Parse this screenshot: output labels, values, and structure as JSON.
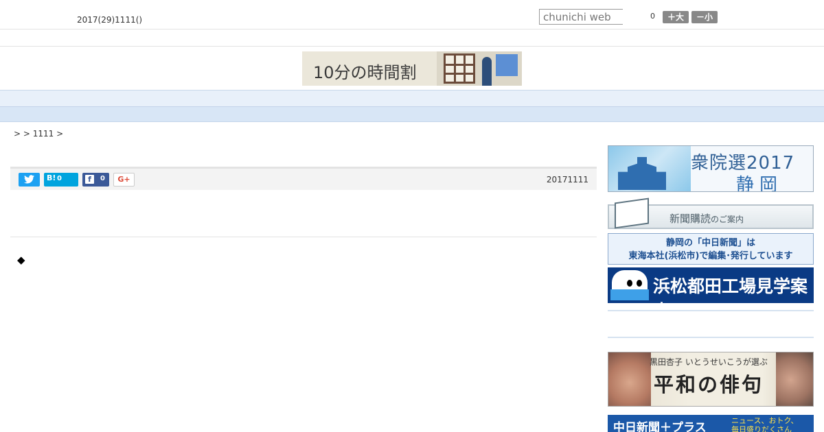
{
  "header": {
    "date": "2017(29)1111()",
    "search_placeholder": "chunichi web",
    "font_size_count": "0",
    "font_bigger_label": "＋大",
    "font_smaller_label": "－小"
  },
  "banner": {
    "text": "10分の時間割"
  },
  "nav": {
    "items": [
      "　　",
      "　　",
      "　　",
      "　　",
      "　　",
      "　　",
      "　　",
      "　　",
      "　　"
    ]
  },
  "breadcrumb": {
    "text": ">  > 1111 >"
  },
  "share": {
    "hatena_label": "B!",
    "hatena_count": "0",
    "facebook_icon": "f",
    "facebook_count": "0",
    "google_label": "G+",
    "article_date": "20171111"
  },
  "article": {
    "bullet": "◆"
  },
  "sidebar": {
    "election_title": "衆院選2017",
    "election_place": "静岡",
    "subscribe_main": "新聞購読",
    "subscribe_sub": "のご案内",
    "info_line1": "静岡の「中日新聞」は",
    "info_line2": "東海本社(浜松市)で編集･発行しています",
    "tour_text": "浜松都田工場見学案内",
    "haiku_sub": "黒田杏子  いとうせいこうが選ぶ",
    "haiku_title": "平和の俳句",
    "plus_title": "中日新聞＋プラス",
    "plus_sub1": "ニュース、おトク、",
    "plus_sub2": "毎日盛りだくさん"
  },
  "colors": {
    "nav_bg": "#e8f0fa",
    "subnav_bg": "#d8e6f6",
    "twitter": "#1da1f2",
    "hatena": "#00a4de",
    "facebook": "#3b5998",
    "tour_bg": "#0a3a84"
  },
  "icons": {
    "twitter": "twitter-bird-icon",
    "hatena": "hatena-bookmark-icon",
    "facebook": "facebook-icon",
    "google": "google-plus-icon"
  }
}
